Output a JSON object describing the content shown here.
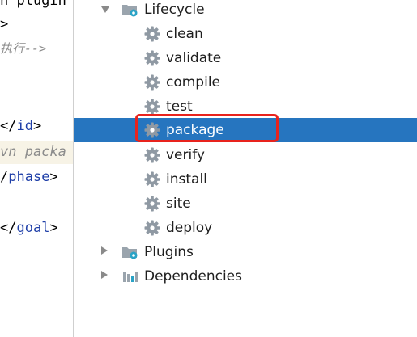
{
  "editor": {
    "lines": [
      {
        "text": "n plugin",
        "kind": "plain"
      },
      {
        "text": ">",
        "kind": "plain"
      },
      {
        "text": "执行-->",
        "kind": "comment"
      },
      {
        "text": "</",
        "tag": "id",
        "close": ">"
      },
      {
        "text": "vn packa",
        "kind": "comment"
      },
      {
        "text": "/",
        "tag": "phase",
        "close": ">"
      },
      {
        "text": "</",
        "tag": "goal",
        "close": ">"
      }
    ]
  },
  "tree": {
    "lifecycle": {
      "label": "Lifecycle",
      "expanded": true
    },
    "phases": [
      {
        "label": "clean"
      },
      {
        "label": "validate"
      },
      {
        "label": "compile"
      },
      {
        "label": "test"
      },
      {
        "label": "package",
        "selected": true
      },
      {
        "label": "verify"
      },
      {
        "label": "install"
      },
      {
        "label": "site"
      },
      {
        "label": "deploy"
      }
    ],
    "plugins": {
      "label": "Plugins",
      "expanded": false
    },
    "dependencies": {
      "label": "Dependencies",
      "expanded": false
    }
  },
  "colors": {
    "selection": "#2675bf",
    "highlight_box": "#e8231d",
    "gear": "#8f99a3",
    "folder": "#9aa4ad",
    "accent_teal": "#2aa3c6"
  },
  "icons": {
    "phase": "gear-icon",
    "lifecycle": "lifecycle-folder-icon",
    "plugins": "plugins-folder-icon",
    "dependencies": "dependencies-icon"
  }
}
